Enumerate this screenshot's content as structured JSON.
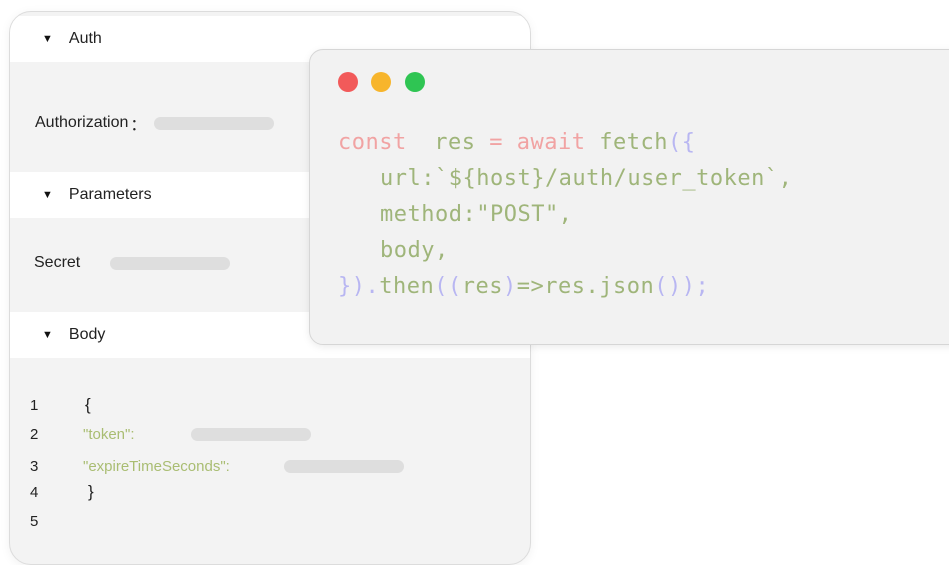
{
  "api_panel": {
    "sections": [
      {
        "label": "Auth"
      },
      {
        "label": "Parameters"
      },
      {
        "label": "Body"
      }
    ],
    "fields": {
      "authorization_label": "Authorization",
      "authorization_sep": "：",
      "secret_label": "Secret"
    },
    "body_code": {
      "line_numbers": [
        "1",
        "2",
        "3",
        "4",
        "5"
      ],
      "open_brace": "{",
      "close_brace": "}",
      "token_key": "\"token\"",
      "token_colon": ":",
      "expire_key": "\"expireTimeSeconds\"",
      "expire_colon": ":"
    }
  },
  "code_window": {
    "window_controls": [
      "close-dot",
      "minimize-dot",
      "maximize-dot"
    ],
    "colors": {
      "close": "#f25a5a",
      "minimize": "#f7b52c",
      "maximize": "#2fc553",
      "keyword": "#f1a3a3",
      "identifier": "#9fb57a",
      "punctuation": "#b8b6f2"
    },
    "lines": [
      {
        "kw1": "const",
        "ident1": "res",
        "op": "=",
        "kw2": "await",
        "ident2": "fetch",
        "punc": "({"
      },
      {
        "text": "url:`${host}/auth/user_token`,"
      },
      {
        "text": "method:\"POST\","
      },
      {
        "text": "body,"
      },
      {
        "p1": "}).",
        "t1": "then",
        "p2": "((",
        "t2": "res",
        "p3": ")",
        "t3": "=>",
        "t4": "res.json",
        "p4": "());"
      }
    ]
  }
}
